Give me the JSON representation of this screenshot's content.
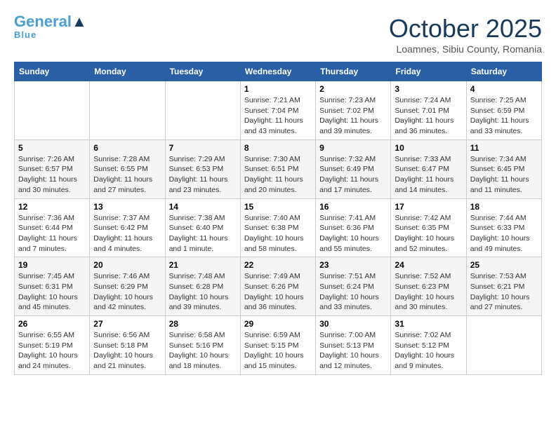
{
  "header": {
    "logo_general": "General",
    "logo_blue": "Blue",
    "month_title": "October 2025",
    "location": "Loamnes, Sibiu County, Romania"
  },
  "days_of_week": [
    "Sunday",
    "Monday",
    "Tuesday",
    "Wednesday",
    "Thursday",
    "Friday",
    "Saturday"
  ],
  "weeks": [
    [
      {
        "day": "",
        "info": ""
      },
      {
        "day": "",
        "info": ""
      },
      {
        "day": "",
        "info": ""
      },
      {
        "day": "1",
        "info": "Sunrise: 7:21 AM\nSunset: 7:04 PM\nDaylight: 11 hours\nand 43 minutes."
      },
      {
        "day": "2",
        "info": "Sunrise: 7:23 AM\nSunset: 7:02 PM\nDaylight: 11 hours\nand 39 minutes."
      },
      {
        "day": "3",
        "info": "Sunrise: 7:24 AM\nSunset: 7:01 PM\nDaylight: 11 hours\nand 36 minutes."
      },
      {
        "day": "4",
        "info": "Sunrise: 7:25 AM\nSunset: 6:59 PM\nDaylight: 11 hours\nand 33 minutes."
      }
    ],
    [
      {
        "day": "5",
        "info": "Sunrise: 7:26 AM\nSunset: 6:57 PM\nDaylight: 11 hours\nand 30 minutes."
      },
      {
        "day": "6",
        "info": "Sunrise: 7:28 AM\nSunset: 6:55 PM\nDaylight: 11 hours\nand 27 minutes."
      },
      {
        "day": "7",
        "info": "Sunrise: 7:29 AM\nSunset: 6:53 PM\nDaylight: 11 hours\nand 23 minutes."
      },
      {
        "day": "8",
        "info": "Sunrise: 7:30 AM\nSunset: 6:51 PM\nDaylight: 11 hours\nand 20 minutes."
      },
      {
        "day": "9",
        "info": "Sunrise: 7:32 AM\nSunset: 6:49 PM\nDaylight: 11 hours\nand 17 minutes."
      },
      {
        "day": "10",
        "info": "Sunrise: 7:33 AM\nSunset: 6:47 PM\nDaylight: 11 hours\nand 14 minutes."
      },
      {
        "day": "11",
        "info": "Sunrise: 7:34 AM\nSunset: 6:45 PM\nDaylight: 11 hours\nand 11 minutes."
      }
    ],
    [
      {
        "day": "12",
        "info": "Sunrise: 7:36 AM\nSunset: 6:44 PM\nDaylight: 11 hours\nand 7 minutes."
      },
      {
        "day": "13",
        "info": "Sunrise: 7:37 AM\nSunset: 6:42 PM\nDaylight: 11 hours\nand 4 minutes."
      },
      {
        "day": "14",
        "info": "Sunrise: 7:38 AM\nSunset: 6:40 PM\nDaylight: 11 hours\nand 1 minute."
      },
      {
        "day": "15",
        "info": "Sunrise: 7:40 AM\nSunset: 6:38 PM\nDaylight: 10 hours\nand 58 minutes."
      },
      {
        "day": "16",
        "info": "Sunrise: 7:41 AM\nSunset: 6:36 PM\nDaylight: 10 hours\nand 55 minutes."
      },
      {
        "day": "17",
        "info": "Sunrise: 7:42 AM\nSunset: 6:35 PM\nDaylight: 10 hours\nand 52 minutes."
      },
      {
        "day": "18",
        "info": "Sunrise: 7:44 AM\nSunset: 6:33 PM\nDaylight: 10 hours\nand 49 minutes."
      }
    ],
    [
      {
        "day": "19",
        "info": "Sunrise: 7:45 AM\nSunset: 6:31 PM\nDaylight: 10 hours\nand 45 minutes."
      },
      {
        "day": "20",
        "info": "Sunrise: 7:46 AM\nSunset: 6:29 PM\nDaylight: 10 hours\nand 42 minutes."
      },
      {
        "day": "21",
        "info": "Sunrise: 7:48 AM\nSunset: 6:28 PM\nDaylight: 10 hours\nand 39 minutes."
      },
      {
        "day": "22",
        "info": "Sunrise: 7:49 AM\nSunset: 6:26 PM\nDaylight: 10 hours\nand 36 minutes."
      },
      {
        "day": "23",
        "info": "Sunrise: 7:51 AM\nSunset: 6:24 PM\nDaylight: 10 hours\nand 33 minutes."
      },
      {
        "day": "24",
        "info": "Sunrise: 7:52 AM\nSunset: 6:23 PM\nDaylight: 10 hours\nand 30 minutes."
      },
      {
        "day": "25",
        "info": "Sunrise: 7:53 AM\nSunset: 6:21 PM\nDaylight: 10 hours\nand 27 minutes."
      }
    ],
    [
      {
        "day": "26",
        "info": "Sunrise: 6:55 AM\nSunset: 5:19 PM\nDaylight: 10 hours\nand 24 minutes."
      },
      {
        "day": "27",
        "info": "Sunrise: 6:56 AM\nSunset: 5:18 PM\nDaylight: 10 hours\nand 21 minutes."
      },
      {
        "day": "28",
        "info": "Sunrise: 6:58 AM\nSunset: 5:16 PM\nDaylight: 10 hours\nand 18 minutes."
      },
      {
        "day": "29",
        "info": "Sunrise: 6:59 AM\nSunset: 5:15 PM\nDaylight: 10 hours\nand 15 minutes."
      },
      {
        "day": "30",
        "info": "Sunrise: 7:00 AM\nSunset: 5:13 PM\nDaylight: 10 hours\nand 12 minutes."
      },
      {
        "day": "31",
        "info": "Sunrise: 7:02 AM\nSunset: 5:12 PM\nDaylight: 10 hours\nand 9 minutes."
      },
      {
        "day": "",
        "info": ""
      }
    ]
  ]
}
